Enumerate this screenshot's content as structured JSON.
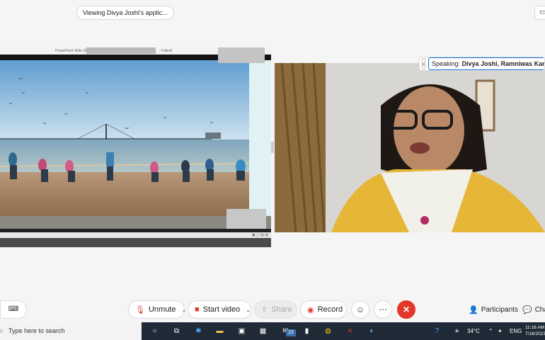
{
  "viewing_label": "Viewing Divya Joshi's applic...",
  "corner_icon": "window-icon",
  "share": {
    "app_title": "PowerPoint Slide Show",
    "title_tail": "- Failed)",
    "status_text": "▣  ▢  ▤  ▥"
  },
  "speaking": {
    "prefix": "Speaking:",
    "names": "Divya Joshi, Ramniwas Kargu"
  },
  "toolbar": {
    "cc_icon": "captions-icon",
    "unmute": "Unmute",
    "start_video": "Start video",
    "share": "Share",
    "record": "Record",
    "reactions_icon": "emoji-icon",
    "more_icon": "more-icon",
    "end_icon": "close-icon",
    "participants": "Participants",
    "chat": "Chat"
  },
  "taskbar": {
    "search_placeholder": "Type here to search",
    "badge_count": "22",
    "temperature": "34°C",
    "language": "ENG",
    "time": "11:16 AM",
    "date": "7/18/2023"
  },
  "colors": {
    "accent_blue": "#0b6fd4",
    "end_red": "#e2382c",
    "taskbar": "#1f2a36"
  }
}
